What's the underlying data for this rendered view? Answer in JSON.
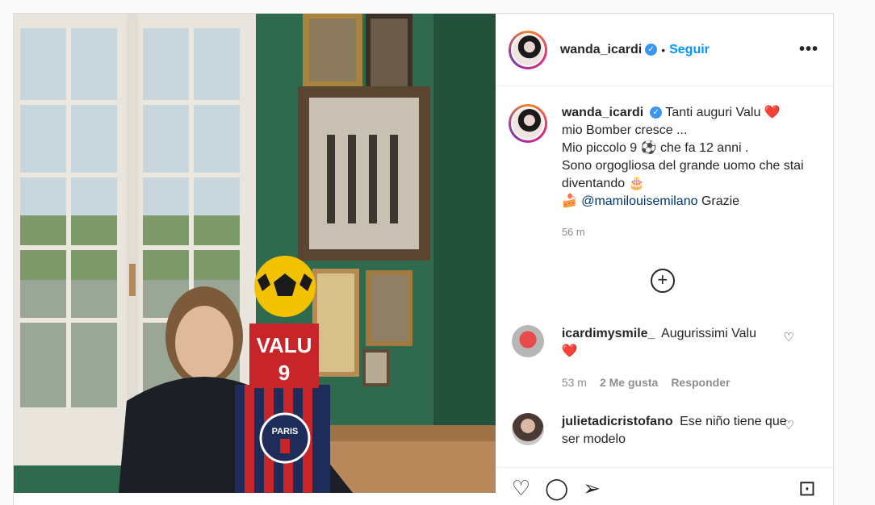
{
  "post": {
    "username": "wanda_icardi",
    "verified_icon": "verified-badge-icon",
    "separator": "•",
    "follow_label": "Seguir",
    "more_label": "•••",
    "caption": {
      "line1": "Tanti auguri Valu",
      "heart1": "❤️",
      "line2": "mio Bomber cresce ...",
      "line3a": "Mio piccolo 9",
      "ball": "⚽",
      "line3b": "che fa 12 anni .",
      "line4": "Sono orgogliosa del grande uomo che stai diventando",
      "cake": "🎂",
      "slice": "🍰",
      "mention": "@mamilouisemilano",
      "thanks": "Grazie"
    },
    "time": "56 m",
    "load_more_icon": "+"
  },
  "photo": {
    "cake_name": "VALU",
    "cake_number": "9",
    "club_text": "PARIS"
  },
  "comments": [
    {
      "username": "icardimysmile_",
      "text": "Augurissimi Valu",
      "emoji": "❤️",
      "time": "53 m",
      "likes": "2 Me gusta",
      "reply": "Responder"
    },
    {
      "username": "julietadicristofano",
      "text": "Ese niño tiene que ser modelo"
    }
  ],
  "actions": {
    "like_icon": "♡",
    "comment_icon": "◯",
    "share_icon": "➢",
    "save_icon": "⊡"
  },
  "colors": {
    "accent": "#0095f6",
    "verified": "#3897f0",
    "wall": "#2f6a4e"
  }
}
